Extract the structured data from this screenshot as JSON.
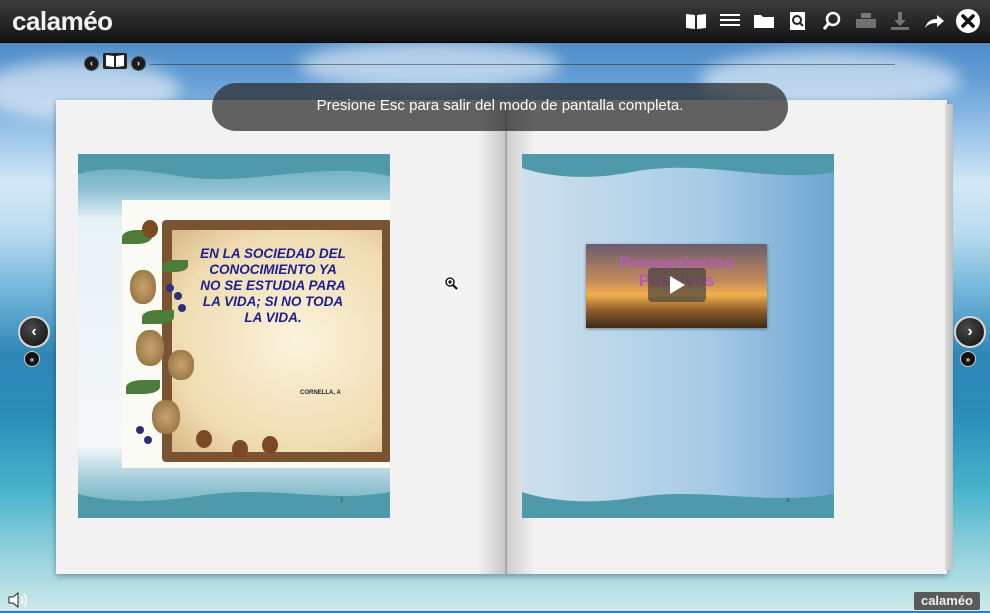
{
  "app": {
    "logo": "calaméo"
  },
  "toolbar": {
    "icons": [
      "book-view-icon",
      "list-icon",
      "folder-icon",
      "search-page-icon",
      "zoom-icon",
      "print-icon",
      "download-icon",
      "share-icon",
      "close-icon"
    ]
  },
  "banner": {
    "text": "Presione Esc para salir del modo de pantalla completa."
  },
  "left_page": {
    "quote": "EN LA SOCIEDAD DEL CONOCIMIENTO YA NO SE ESTUDIA PARA LA VIDA; SI NO TODA LA VIDA.",
    "author": "CORNELLA, A",
    "page_number": "2"
  },
  "right_page": {
    "video_title": "Pensamientos Positivos",
    "page_number": "3"
  },
  "footer": {
    "brand": "calaméo"
  },
  "colors": {
    "accent_quote": "#1c1f8c",
    "video_title": "#b35ab8",
    "topbar": "#1e1e1e"
  }
}
